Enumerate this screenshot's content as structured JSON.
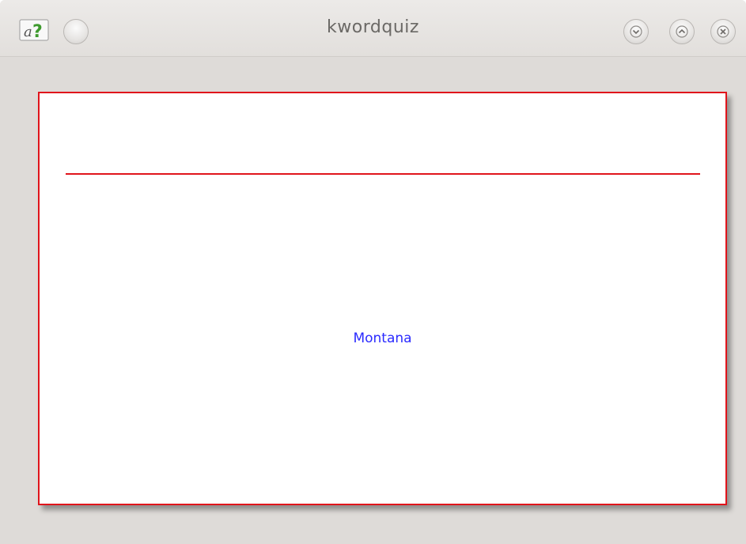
{
  "window": {
    "title": "kwordquiz",
    "icons": {
      "app": "kwordquiz-app-icon",
      "menu": "window-menu-button",
      "minimize": "chevron-down-icon",
      "maximize": "chevron-up-icon",
      "close": "close-icon"
    }
  },
  "flashcard": {
    "question": "",
    "answer": "Montana",
    "border_color": "#e0141b",
    "text_color": "#2a2aff"
  }
}
